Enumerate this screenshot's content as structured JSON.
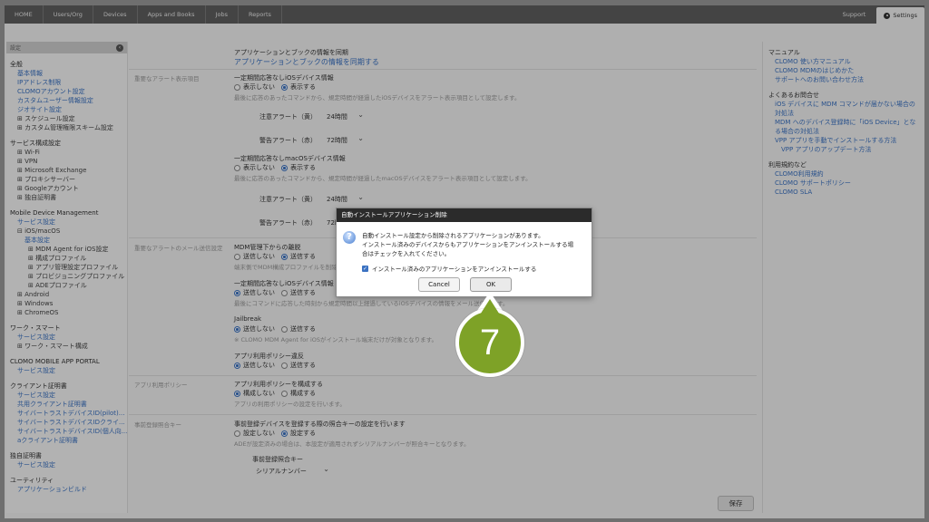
{
  "nav": {
    "items": [
      "HOME",
      "Users/Org",
      "Devices",
      "Apps and Books",
      "Jobs",
      "Reports"
    ],
    "support": "Support",
    "settings": "Settings"
  },
  "sidebar": {
    "header": "設定",
    "sections": [
      {
        "title": "全般",
        "items": [
          {
            "label": "基本情報",
            "type": "link"
          },
          {
            "label": "IPアドレス制限",
            "type": "link"
          },
          {
            "label": "CLOMOアカウント設定",
            "type": "link"
          },
          {
            "label": "カスタムユーザー情報設定",
            "type": "link"
          },
          {
            "label": "ジオサイト設定",
            "type": "link"
          },
          {
            "label": "⊞ スケジュール設定",
            "type": "plain"
          },
          {
            "label": "⊞ カスタム管理権限スキーム設定",
            "type": "plain"
          }
        ]
      },
      {
        "title": "サービス構成設定",
        "items": [
          {
            "label": "⊞ Wi-Fi",
            "type": "plain"
          },
          {
            "label": "⊞ VPN",
            "type": "plain"
          },
          {
            "label": "⊞ Microsoft Exchange",
            "type": "plain"
          },
          {
            "label": "⊞ プロキシサーバー",
            "type": "plain"
          },
          {
            "label": "⊞ Googleアカウント",
            "type": "plain"
          },
          {
            "label": "⊞ 独自証明書",
            "type": "plain"
          }
        ]
      },
      {
        "title": "Mobile Device Management",
        "items": [
          {
            "label": "サービス設定",
            "type": "link"
          },
          {
            "label": "⊟ iOS/macOS",
            "type": "plain"
          },
          {
            "label": "基本設定",
            "type": "link2"
          },
          {
            "label": "⊞ MDM Agent for iOS設定",
            "type": "plain3"
          },
          {
            "label": "⊞ 構成プロファイル",
            "type": "plain3"
          },
          {
            "label": "⊞ アプリ管理設定プロファイル",
            "type": "plain3"
          },
          {
            "label": "⊞ プロビジョニングプロファイル",
            "type": "plain3"
          },
          {
            "label": "⊞ ADEプロファイル",
            "type": "plain3"
          },
          {
            "label": "⊞ Android",
            "type": "plain"
          },
          {
            "label": "⊞ Windows",
            "type": "plain"
          },
          {
            "label": "⊞ ChromeOS",
            "type": "plain"
          }
        ]
      },
      {
        "title": "ワーク・スマート",
        "items": [
          {
            "label": "サービス設定",
            "type": "link"
          },
          {
            "label": "⊞ ワーク・スマート構成",
            "type": "plain"
          }
        ]
      },
      {
        "title": "CLOMO MOBILE APP PORTAL",
        "items": [
          {
            "label": "サービス設定",
            "type": "link"
          }
        ]
      },
      {
        "title": "クライアント証明書",
        "items": [
          {
            "label": "サービス設定",
            "type": "link"
          },
          {
            "label": "共用クライアント証明書",
            "type": "link"
          },
          {
            "label": "サイバートラストデバイスID(pilot)...",
            "type": "link"
          },
          {
            "label": "サイバートラストデバイスIDクライ...",
            "type": "link"
          },
          {
            "label": "サイバートラストデバイスID(個人向...",
            "type": "link"
          },
          {
            "label": "aクライアント証明書",
            "type": "link"
          }
        ]
      },
      {
        "title": "独自証明書",
        "items": [
          {
            "label": "サービス設定",
            "type": "link"
          }
        ]
      },
      {
        "title": "ユーティリティ",
        "items": [
          {
            "label": "アプリケーションビルド",
            "type": "link"
          }
        ]
      }
    ]
  },
  "main": {
    "sync_heading": "アプリケーションとブックの情報を同期",
    "sync_link": "アプリケーションとブックの情報を同期する",
    "alert_section_label": "重要なアラート表示項目",
    "ios_unresponsive": "一定期間応答なしiOSデバイス情報",
    "hide": "表示しない",
    "show": "表示する",
    "ios_note": "最後に応答のあったコマンドから、規定時間が経過したiOSデバイスをアラート表示項目として設定します。",
    "caution_alert": "注意アラート（黄）",
    "caution_value": "24時間",
    "warning_alert": "警告アラート（赤）",
    "warning_value": "72時間",
    "macos_unresponsive": "一定期間応答なしmacOSデバイス情報",
    "macos_note": "最後に応答のあったコマンドから、規定時間が経過したmacOSデバイスをアラート表示項目として設定します。",
    "macos_caution_value": "24時間",
    "macos_warning_value": "72時間",
    "mail_section_label": "重要なアラートのメール送信設定",
    "mdm_disable": "MDM管理下からの離脱",
    "not_send": "送信しない",
    "send": "送信する",
    "mdm_note": "端末側でMDM構成プロファイルを削除...",
    "ios_unresponsive2": "一定期間応答なしiOSデバイス情報",
    "ios_note2": "最後にコマンドに応答した時刻から規定時間以上経過しているiOSデバイスの情報をメール送信します。",
    "jailbreak": "Jailbreak",
    "jailbreak_note": "※ CLOMO MDM Agent for iOSがインストール端末だけが対象となります。",
    "app_policy_violation": "アプリ利用ポリシー違反",
    "app_policy_label": "アプリ利用ポリシー",
    "app_policy_config": "アプリ利用ポリシーを構成する",
    "configure": "構成しない",
    "configure_on": "構成する",
    "app_policy_note": "アプリの利用ポリシーの設定を行います。",
    "prereg_label": "事前登録照合キー",
    "prereg_heading": "事前登録デバイスを登録する際の照合キーの設定を行います",
    "no_set": "設定しない",
    "set": "設定する",
    "prereg_note": "ADEが設定済みの場合は、本設定が適用されずシリアルナンバーが照合キーとなります。",
    "prereg_key_label": "事前登録照合キー",
    "prereg_key_value": "シリアルナンバー",
    "save": "保存"
  },
  "right_panel": {
    "manual_title": "マニュアル",
    "manual_links": [
      "CLOMO 使い方マニュアル",
      "CLOMO MDMのはじめかた",
      "サポートへのお問い合わせ方法"
    ],
    "faq_title": "よくあるお問合せ",
    "faq_links": [
      "iOS デバイスに MDM コマンドが届かない場合の対処法",
      "MDM へのデバイス登録時に「iOS Device」となる場合の対処法",
      "VPP アプリを手動でインストールする方法"
    ],
    "faq_sub": "VPP アプリのアップデート方法",
    "terms_title": "利用規約など",
    "terms_links": [
      "CLOMO利用規約",
      "CLOMO サポートポリシー",
      "CLOMO SLA"
    ]
  },
  "dialog": {
    "title": "自動インストールアプリケーション削除",
    "line1": "自動インストール設定から削除されるアプリケーションがあります。",
    "line2": "インストール済みのデバイスからもアプリケーションをアンインストールする場",
    "line3": "合はチェックを入れてください。",
    "checkbox_label": "インストール済みのアプリケーションをアンインストールする",
    "cancel": "Cancel",
    "ok": "OK"
  },
  "step_marker": "7",
  "colors": {
    "accent": "#3b72c2",
    "marker": "#7ea227",
    "nav": "#5f5f5f"
  }
}
